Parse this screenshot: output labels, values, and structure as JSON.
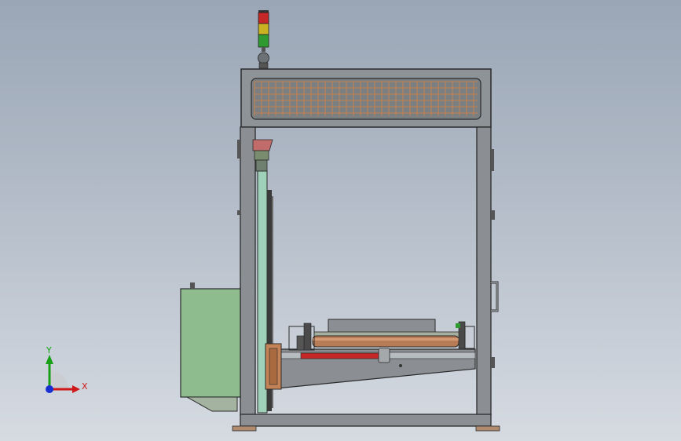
{
  "viewport": {
    "background_top": "#9aa6b6",
    "background_bottom": "#d6dbe2"
  },
  "triad": {
    "x_label": "X",
    "y_label": "Y",
    "x_color": "#d01818",
    "y_color": "#18a018",
    "z_color": "#1830d0"
  },
  "signal_tower": {
    "lights": [
      "red",
      "yellow",
      "green"
    ]
  }
}
